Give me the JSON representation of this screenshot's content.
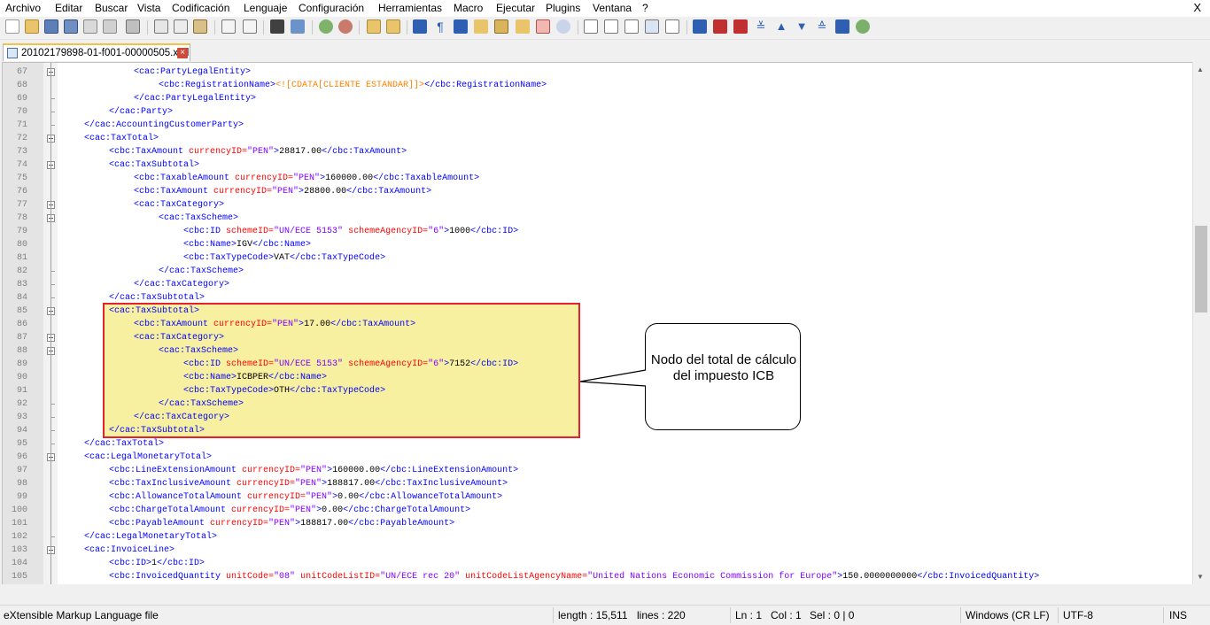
{
  "menubar": {
    "items": [
      "Archivo",
      "Editar",
      "Buscar",
      "Vista",
      "Codificación",
      "Lenguaje",
      "Configuración",
      "Herramientas",
      "Macro",
      "Ejecutar",
      "Plugins",
      "Ventana",
      "?"
    ],
    "close": "X"
  },
  "tab": {
    "filename": "20102179898-01-f001-00000505.xml",
    "close": "×"
  },
  "code_lines": [
    {
      "n": "67",
      "segs": [
        [
          "t",
          "<cac:PartyLegalEntity>"
        ]
      ]
    },
    {
      "n": "68",
      "segs": [
        [
          "t",
          "<cbc:RegistrationName>"
        ],
        [
          "c",
          "<![CDATA[CLIENTE ESTANDAR]]>"
        ],
        [
          "t",
          "</cbc:RegistrationName>"
        ]
      ]
    },
    {
      "n": "69",
      "segs": [
        [
          "t",
          "</cac:PartyLegalEntity>"
        ]
      ]
    },
    {
      "n": "70",
      "segs": [
        [
          "t",
          "</cac:Party>"
        ]
      ]
    },
    {
      "n": "71",
      "segs": [
        [
          "t",
          "</cac:AccountingCustomerParty>"
        ]
      ]
    },
    {
      "n": "72",
      "segs": [
        [
          "t",
          "<cac:TaxTotal>"
        ]
      ]
    },
    {
      "n": "73",
      "segs": [
        [
          "t",
          "<cbc:TaxAmount "
        ],
        [
          "a",
          "currencyID="
        ],
        [
          "v",
          "\"PEN\""
        ],
        [
          "t",
          ">"
        ],
        [
          "x",
          "28817.00"
        ],
        [
          "t",
          "</cbc:TaxAmount>"
        ]
      ]
    },
    {
      "n": "74",
      "segs": [
        [
          "t",
          "<cac:TaxSubtotal>"
        ]
      ]
    },
    {
      "n": "75",
      "segs": [
        [
          "t",
          "<cbc:TaxableAmount "
        ],
        [
          "a",
          "currencyID="
        ],
        [
          "v",
          "\"PEN\""
        ],
        [
          "t",
          ">"
        ],
        [
          "x",
          "160000.00"
        ],
        [
          "t",
          "</cbc:TaxableAmount>"
        ]
      ]
    },
    {
      "n": "76",
      "segs": [
        [
          "t",
          "<cbc:TaxAmount "
        ],
        [
          "a",
          "currencyID="
        ],
        [
          "v",
          "\"PEN\""
        ],
        [
          "t",
          ">"
        ],
        [
          "x",
          "28800.00"
        ],
        [
          "t",
          "</cbc:TaxAmount>"
        ]
      ]
    },
    {
      "n": "77",
      "segs": [
        [
          "t",
          "<cac:TaxCategory>"
        ]
      ]
    },
    {
      "n": "78",
      "segs": [
        [
          "t",
          "<cac:TaxScheme>"
        ]
      ]
    },
    {
      "n": "79",
      "segs": [
        [
          "t",
          "<cbc:ID "
        ],
        [
          "a",
          "schemeID="
        ],
        [
          "v",
          "\"UN/ECE 5153\""
        ],
        [
          "t",
          " "
        ],
        [
          "a",
          "schemeAgencyID="
        ],
        [
          "v",
          "\"6\""
        ],
        [
          "t",
          ">"
        ],
        [
          "x",
          "1000"
        ],
        [
          "t",
          "</cbc:ID>"
        ]
      ]
    },
    {
      "n": "80",
      "segs": [
        [
          "t",
          "<cbc:Name>"
        ],
        [
          "x",
          "IGV"
        ],
        [
          "t",
          "</cbc:Name>"
        ]
      ]
    },
    {
      "n": "81",
      "segs": [
        [
          "t",
          "<cbc:TaxTypeCode>"
        ],
        [
          "x",
          "VAT"
        ],
        [
          "t",
          "</cbc:TaxTypeCode>"
        ]
      ]
    },
    {
      "n": "82",
      "segs": [
        [
          "t",
          "</cac:TaxScheme>"
        ]
      ]
    },
    {
      "n": "83",
      "segs": [
        [
          "t",
          "</cac:TaxCategory>"
        ]
      ]
    },
    {
      "n": "84",
      "segs": [
        [
          "t",
          "</cac:TaxSubtotal>"
        ]
      ]
    },
    {
      "n": "85",
      "segs": [
        [
          "t",
          "<cac:TaxSubtotal>"
        ]
      ]
    },
    {
      "n": "86",
      "segs": [
        [
          "t",
          "<cbc:TaxAmount "
        ],
        [
          "a",
          "currencyID="
        ],
        [
          "v",
          "\"PEN\""
        ],
        [
          "t",
          ">"
        ],
        [
          "x",
          "17.00"
        ],
        [
          "t",
          "</cbc:TaxAmount>"
        ]
      ]
    },
    {
      "n": "87",
      "segs": [
        [
          "t",
          "<cac:TaxCategory>"
        ]
      ]
    },
    {
      "n": "88",
      "segs": [
        [
          "t",
          "<cac:TaxScheme>"
        ]
      ]
    },
    {
      "n": "89",
      "segs": [
        [
          "t",
          "<cbc:ID "
        ],
        [
          "a",
          "schemeID="
        ],
        [
          "v",
          "\"UN/ECE 5153\""
        ],
        [
          "t",
          " "
        ],
        [
          "a",
          "schemeAgencyID="
        ],
        [
          "v",
          "\"6\""
        ],
        [
          "t",
          ">"
        ],
        [
          "x",
          "7152"
        ],
        [
          "t",
          "</cbc:ID>"
        ]
      ]
    },
    {
      "n": "90",
      "segs": [
        [
          "t",
          "<cbc:Name>"
        ],
        [
          "x",
          "ICBPER"
        ],
        [
          "t",
          "</cbc:Name>"
        ]
      ]
    },
    {
      "n": "91",
      "segs": [
        [
          "t",
          "<cbc:TaxTypeCode>"
        ],
        [
          "x",
          "OTH"
        ],
        [
          "t",
          "</cbc:TaxTypeCode>"
        ]
      ]
    },
    {
      "n": "92",
      "segs": [
        [
          "t",
          "</cac:TaxScheme>"
        ]
      ]
    },
    {
      "n": "93",
      "segs": [
        [
          "t",
          "</cac:TaxCategory>"
        ]
      ]
    },
    {
      "n": "94",
      "segs": [
        [
          "t",
          "</cac:TaxSubtotal>"
        ]
      ]
    },
    {
      "n": "95",
      "segs": [
        [
          "t",
          "</cac:TaxTotal>"
        ]
      ]
    },
    {
      "n": "96",
      "segs": [
        [
          "t",
          "<cac:LegalMonetaryTotal>"
        ]
      ]
    },
    {
      "n": "97",
      "segs": [
        [
          "t",
          "<cbc:LineExtensionAmount "
        ],
        [
          "a",
          "currencyID="
        ],
        [
          "v",
          "\"PEN\""
        ],
        [
          "t",
          ">"
        ],
        [
          "x",
          "160000.00"
        ],
        [
          "t",
          "</cbc:LineExtensionAmount>"
        ]
      ]
    },
    {
      "n": "98",
      "segs": [
        [
          "t",
          "<cbc:TaxInclusiveAmount "
        ],
        [
          "a",
          "currencyID="
        ],
        [
          "v",
          "\"PEN\""
        ],
        [
          "t",
          ">"
        ],
        [
          "x",
          "188817.00"
        ],
        [
          "t",
          "</cbc:TaxInclusiveAmount>"
        ]
      ]
    },
    {
      "n": "99",
      "segs": [
        [
          "t",
          "<cbc:AllowanceTotalAmount "
        ],
        [
          "a",
          "currencyID="
        ],
        [
          "v",
          "\"PEN\""
        ],
        [
          "t",
          ">"
        ],
        [
          "x",
          "0.00"
        ],
        [
          "t",
          "</cbc:AllowanceTotalAmount>"
        ]
      ]
    },
    {
      "n": "100",
      "segs": [
        [
          "t",
          "<cbc:ChargeTotalAmount "
        ],
        [
          "a",
          "currencyID="
        ],
        [
          "v",
          "\"PEN\""
        ],
        [
          "t",
          ">"
        ],
        [
          "x",
          "0.00"
        ],
        [
          "t",
          "</cbc:ChargeTotalAmount>"
        ]
      ]
    },
    {
      "n": "101",
      "segs": [
        [
          "t",
          "<cbc:PayableAmount "
        ],
        [
          "a",
          "currencyID="
        ],
        [
          "v",
          "\"PEN\""
        ],
        [
          "t",
          ">"
        ],
        [
          "x",
          "188817.00"
        ],
        [
          "t",
          "</cbc:PayableAmount>"
        ]
      ]
    },
    {
      "n": "102",
      "segs": [
        [
          "t",
          "</cac:LegalMonetaryTotal>"
        ]
      ]
    },
    {
      "n": "103",
      "segs": [
        [
          "t",
          "<cac:InvoiceLine>"
        ]
      ]
    },
    {
      "n": "104",
      "segs": [
        [
          "t",
          "<cbc:ID>"
        ],
        [
          "x",
          "1"
        ],
        [
          "t",
          "</cbc:ID>"
        ]
      ]
    },
    {
      "n": "105",
      "segs": [
        [
          "t",
          "<cbc:InvoicedQuantity "
        ],
        [
          "a",
          "unitCode="
        ],
        [
          "v",
          "\"08\""
        ],
        [
          "t",
          " "
        ],
        [
          "a",
          "unitCodeListID="
        ],
        [
          "v",
          "\"UN/ECE rec 20\""
        ],
        [
          "t",
          " "
        ],
        [
          "a",
          "unitCodeListAgencyName="
        ],
        [
          "v",
          "\"United Nations Economic Commission for Europe\""
        ],
        [
          "t",
          ">"
        ],
        [
          "x",
          "150.0000000000"
        ],
        [
          "t",
          "</cbc:InvoicedQuantity>"
        ]
      ]
    }
  ],
  "callout": {
    "text": "Nodo del total de cálculo del impuesto ICB"
  },
  "status": {
    "filetype": "eXtensible Markup Language file",
    "length": "length : 15,511",
    "lines": "lines : 220",
    "ln": "Ln : 1",
    "col": "Col : 1",
    "sel": "Sel : 0 | 0",
    "eol": "Windows (CR LF)",
    "encoding": "UTF-8",
    "mode": "INS"
  },
  "colors": {
    "tag": "#0000ff",
    "attr": "#ff0000",
    "value": "#8000ff",
    "cdata": "#ff8000",
    "highlight_fill": "#f7f0a0",
    "highlight_border": "#e3222d"
  }
}
